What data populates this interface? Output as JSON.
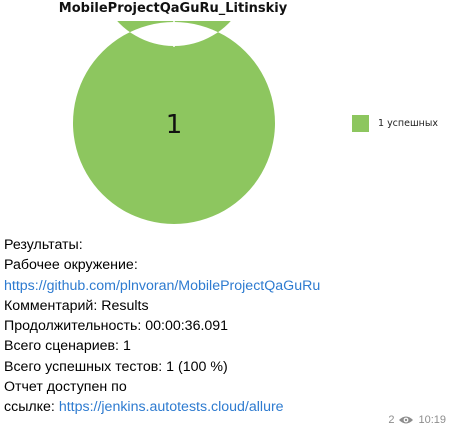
{
  "message": {
    "title": "MobileProjectQaGuRu_Litinskiy",
    "lines": {
      "results": "Результаты:",
      "environment_label": "Рабочее окружение:",
      "environment_link": "https://github.com/plnvoran/MobileProjectQaGuRu",
      "comment_label": "Комментарий:",
      "comment_value": " Results",
      "duration": "Продолжительность: 00:00:36.091",
      "scenarios": "Всего сценариев: 1",
      "passed": "Всего успешных тестов: 1 (100 %)",
      "report_line1": "Отчет доступен по",
      "report_label": "ссылке: ",
      "report_link": "https://jenkins.autotests.cloud/allure"
    },
    "views": "2",
    "time": "10:19"
  },
  "chart_data": {
    "type": "pie",
    "title": "MobileProjectQaGuRu_Litinskiy",
    "center_label": "1",
    "categories": [
      "1 успешных"
    ],
    "values": [
      1
    ],
    "colors": [
      "#8dc65f"
    ],
    "legend_position": "right"
  }
}
